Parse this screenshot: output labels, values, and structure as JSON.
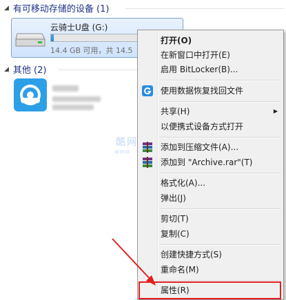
{
  "groups": {
    "removable": {
      "title": "有可移动存储的设备 (1)"
    },
    "other": {
      "title": "其他 (2)"
    }
  },
  "drive": {
    "name": "云骑士U盘 (G:)",
    "space": "14.4 GB 可用，共 14.5",
    "used_fraction": 0.02
  },
  "other_item": {
    "icon": "cloud-icon",
    "name_obscured": true
  },
  "watermark": {
    "text": "酷网",
    "sub": "www"
  },
  "context_menu": {
    "items": {
      "open": "打开(O)",
      "open_new_window": "在新窗口中打开(E)",
      "bitlocker": "启用 BitLocker(B)...",
      "recover": "使用数据恢复找回文件",
      "share": "共享(H)",
      "portable_open": "以便携式设备方式打开",
      "add_archive": "添加到压缩文件(A)...",
      "add_archive_rar": "添加到 \"Archive.rar\"(T)",
      "format": "格式化(A)...",
      "eject": "弹出(J)",
      "cut": "剪切(T)",
      "copy": "复制(C)",
      "create_shortcut": "创建快捷方式(S)",
      "rename": "重命名(M)",
      "properties": "属性(R)"
    }
  },
  "colors": {
    "accent_red": "#e02020",
    "selection_blue": "#7da2ce",
    "group_header": "#1e3287"
  }
}
